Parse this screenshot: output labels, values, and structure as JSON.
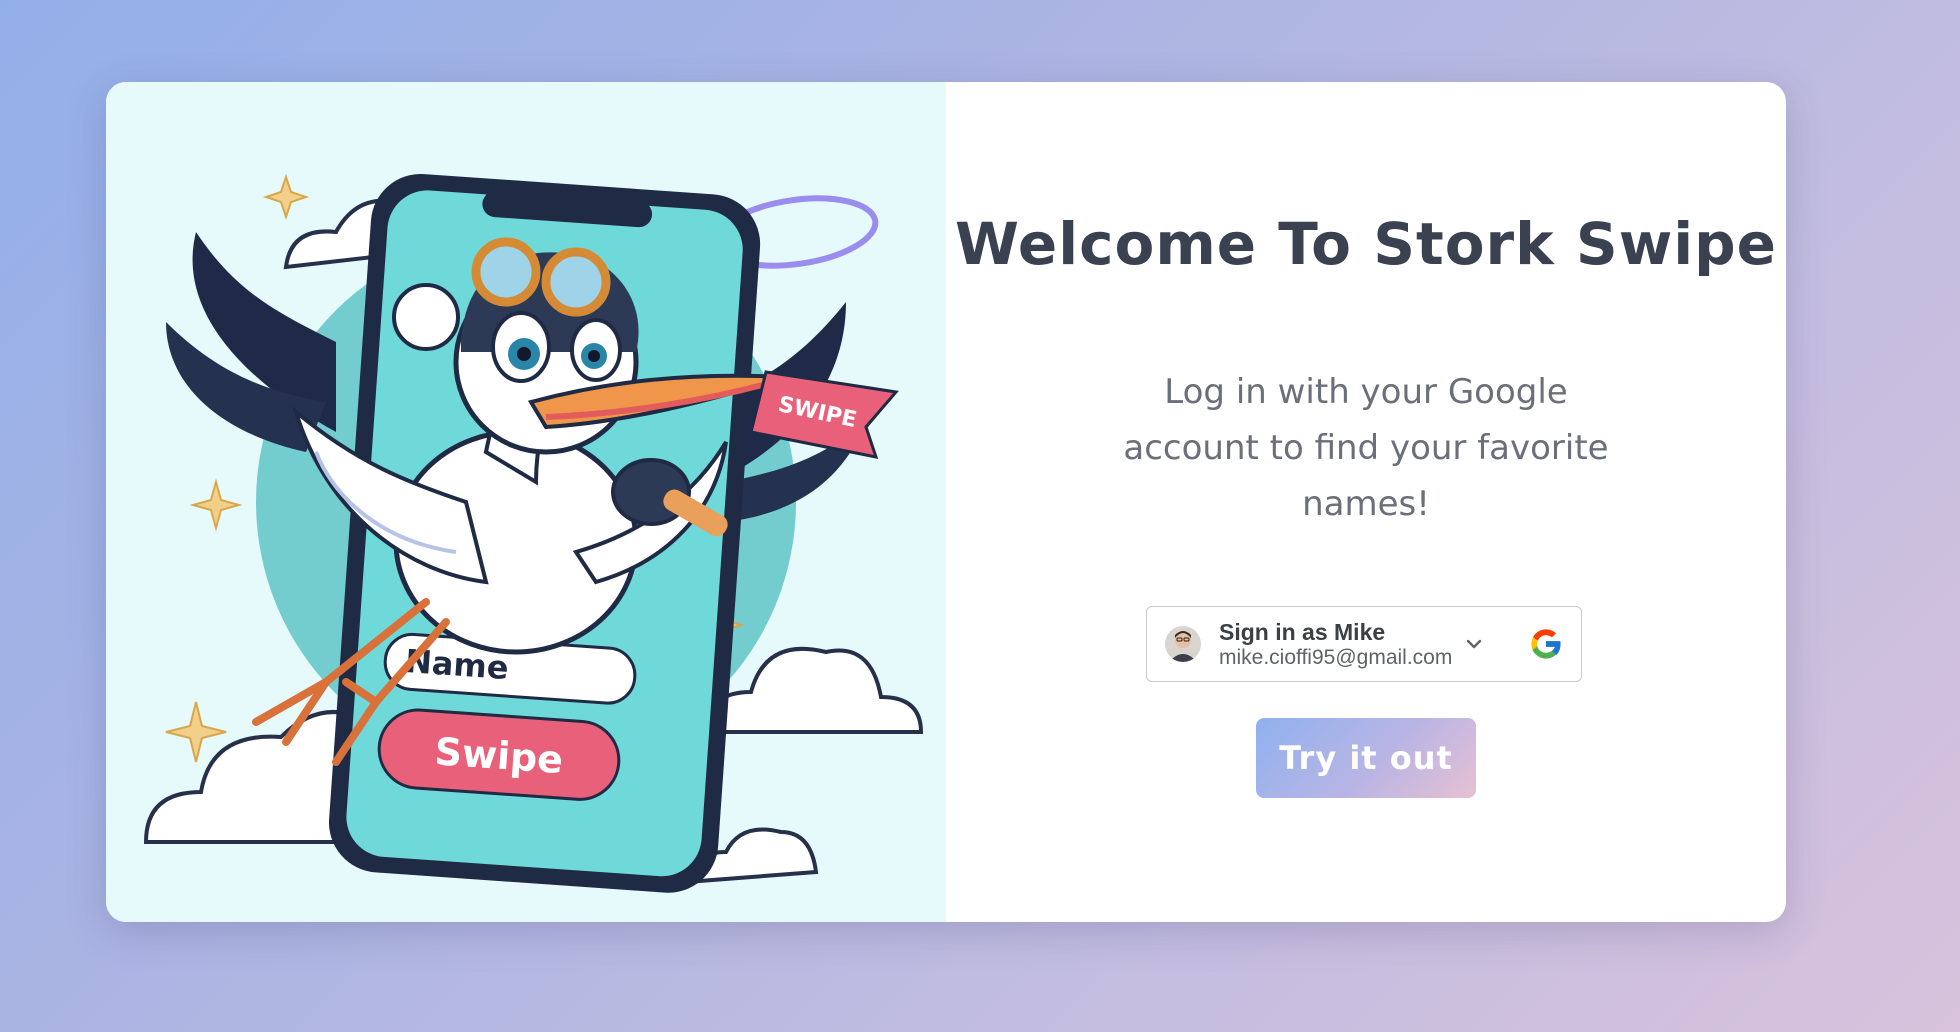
{
  "welcome": {
    "title": "Welcome To Stork Swipe",
    "tagline": "Log in with your Google account to find your favorite names!"
  },
  "google_signin": {
    "name_label": "Sign in as Mike",
    "email": "mike.cioffi95@gmail.com"
  },
  "illustration": {
    "name_field_text": "Name",
    "swipe_button_text": "Swipe",
    "banner_text": "SWIPE"
  },
  "cta": {
    "label": "Try it out"
  },
  "icons": [
    "avatar",
    "chevron-down-icon",
    "google-icon"
  ],
  "colors": {
    "title": "#3a4150",
    "tagline": "#6a6f7a",
    "art_background": "#e6fafb",
    "phone_screen": "#6fd8d8",
    "swipe_pink": "#e9607a"
  }
}
